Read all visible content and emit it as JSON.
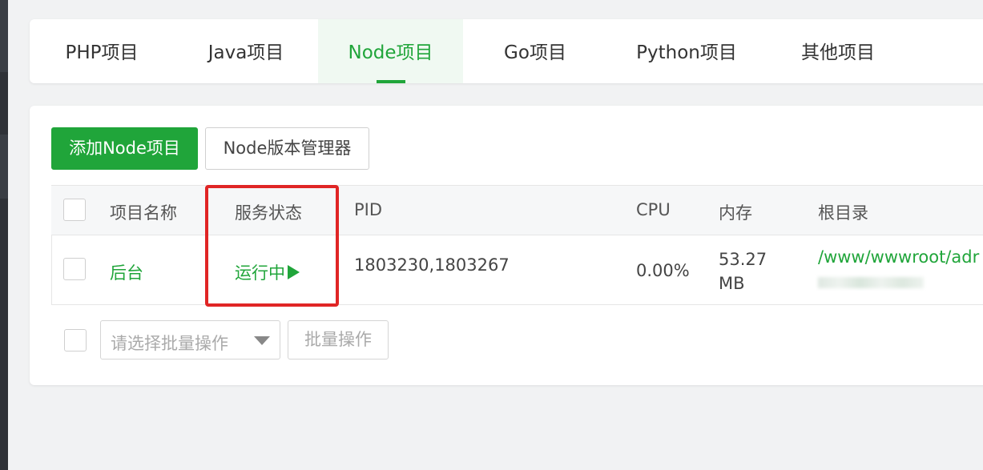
{
  "tabs": [
    {
      "label": "PHP项目"
    },
    {
      "label": "Java项目"
    },
    {
      "label": "Node项目"
    },
    {
      "label": "Go项目"
    },
    {
      "label": "Python项目"
    },
    {
      "label": "其他项目"
    }
  ],
  "active_tab": "Node项目",
  "toolbar": {
    "add_label": "添加Node项目",
    "version_manager_label": "Node版本管理器"
  },
  "table": {
    "headers": {
      "name": "项目名称",
      "status": "服务状态",
      "pid": "PID",
      "cpu": "CPU",
      "memory": "内存",
      "root": "根目录"
    },
    "rows": [
      {
        "name": "后台",
        "status": "运行中",
        "pid": "1803230,1803267",
        "cpu": "0.00%",
        "memory_value": "53.27",
        "memory_unit": "MB",
        "root": "/www/wwwroot/adr"
      }
    ]
  },
  "batch": {
    "select_placeholder": "请选择批量操作",
    "button_label": "批量操作"
  },
  "colors": {
    "accent": "#20a53a",
    "highlight": "#e02525"
  }
}
